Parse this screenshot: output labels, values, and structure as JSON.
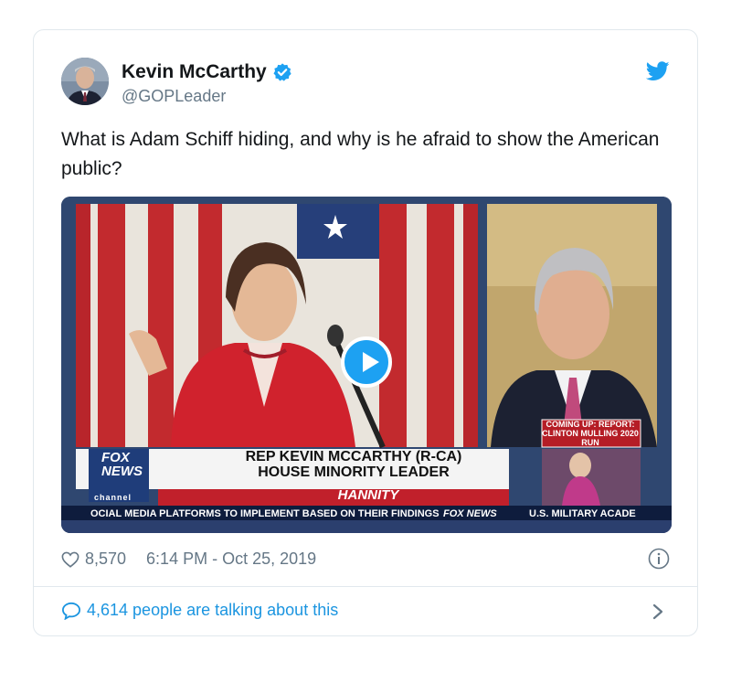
{
  "author": {
    "name": "Kevin McCarthy",
    "handle": "@GOPLeader",
    "verified": true
  },
  "tweet": {
    "text": "What is Adam Schiff hiding, and why is he afraid to show the American public?"
  },
  "video": {
    "lower_third_line1": "REP KEVIN MCCARTHY (R-CA)",
    "lower_third_line2": "HOUSE MINORITY LEADER",
    "show_name": "HANNITY",
    "ticker_text": "OCIAL MEDIA PLATFORMS TO IMPLEMENT BASED ON THEIR FINDINGS",
    "ticker_network": "FOX NEWS",
    "ticker_next": "U.S. MILITARY ACADE",
    "coming_up_line1": "COMING UP: REPORT:",
    "coming_up_line2": "CLINTON MULLING 2020 RUN",
    "logo_line1": "FOX",
    "logo_line2": "NEWS",
    "logo_line3": "channel"
  },
  "meta": {
    "likes": "8,570",
    "timestamp": "6:14 PM - Oct 25, 2019"
  },
  "conversation": {
    "label": "4,614 people are talking about this"
  },
  "colors": {
    "accent": "#1da1f2",
    "link": "#1b95e0",
    "muted": "#657786"
  },
  "icons": [
    "verified-badge-icon",
    "twitter-bird-icon",
    "play-icon",
    "heart-icon",
    "info-icon",
    "speech-bubble-icon",
    "chevron-right-icon"
  ]
}
